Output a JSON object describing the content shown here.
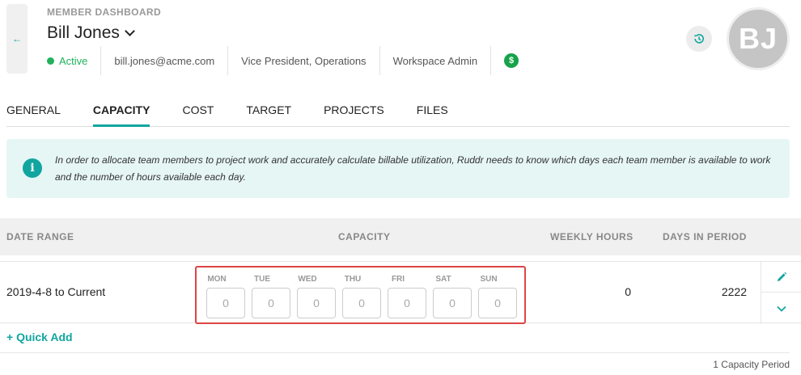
{
  "header": {
    "dashboard_label": "MEMBER DASHBOARD",
    "member_name": "Bill Jones",
    "status": "Active",
    "email": "bill.jones@acme.com",
    "title": "Vice President, Operations",
    "role": "Workspace Admin",
    "billing_badge": "$",
    "avatar_initials": "BJ"
  },
  "tabs": [
    {
      "label": "GENERAL"
    },
    {
      "label": "CAPACITY"
    },
    {
      "label": "COST"
    },
    {
      "label": "TARGET"
    },
    {
      "label": "PROJECTS"
    },
    {
      "label": "FILES"
    }
  ],
  "active_tab": "CAPACITY",
  "info": {
    "text": "In order to allocate team members to project work and accurately calculate billable utilization, Ruddr needs to know which days each team member is available to work and the number of hours available each day."
  },
  "table": {
    "headers": {
      "date_range": "DATE RANGE",
      "capacity": "CAPACITY",
      "weekly_hours": "WEEKLY HOURS",
      "days_in_period": "DAYS IN PERIOD"
    },
    "rows": [
      {
        "date_range": "2019-4-8 to Current",
        "days": [
          {
            "label": "MON",
            "placeholder": "0"
          },
          {
            "label": "TUE",
            "placeholder": "0"
          },
          {
            "label": "WED",
            "placeholder": "0"
          },
          {
            "label": "THU",
            "placeholder": "0"
          },
          {
            "label": "FRI",
            "placeholder": "0"
          },
          {
            "label": "SAT",
            "placeholder": "0"
          },
          {
            "label": "SUN",
            "placeholder": "0"
          }
        ],
        "weekly_hours": "0",
        "days_in_period": "2222"
      }
    ]
  },
  "quick_add_label": "+ Quick Add",
  "footer_count": "1 Capacity Period",
  "colors": {
    "accent": "#12a5a0",
    "status_active": "#1fb25a",
    "highlight_border": "#dc4545",
    "info_bg": "#e6f6f5"
  },
  "icons": [
    "arrow-left-icon",
    "chevron-down-icon",
    "dollar-icon",
    "history-icon",
    "info-icon",
    "pencil-icon",
    "chevron-down-icon"
  ]
}
